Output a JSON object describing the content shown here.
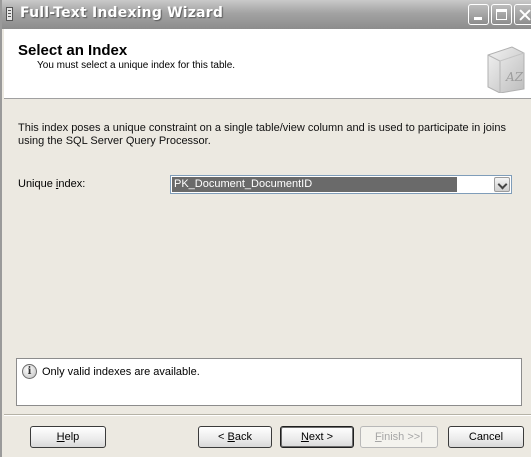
{
  "window": {
    "title": "Full-Text Indexing Wizard"
  },
  "header": {
    "title": "Select an Index",
    "subtitle": "You must select a unique index for this table.",
    "icon": "index-book-icon"
  },
  "description": "This index poses a unique constraint on a single table/view column and is used to participate in joins using the SQL Server Query Processor.",
  "unique_index": {
    "label_pre": "Unique ",
    "label_key": "i",
    "label_post": "ndex:",
    "selected": "PK_Document_DocumentID"
  },
  "info": {
    "icon": "info-icon",
    "text": "Only valid indexes are available."
  },
  "buttons": {
    "help": {
      "key": "H",
      "rest": "elp"
    },
    "back": {
      "pre": "< ",
      "key": "B",
      "rest": "ack"
    },
    "next": {
      "key": "N",
      "rest": "ext >"
    },
    "finish": {
      "key": "F",
      "rest": "inish >>|"
    },
    "cancel": "Cancel"
  }
}
